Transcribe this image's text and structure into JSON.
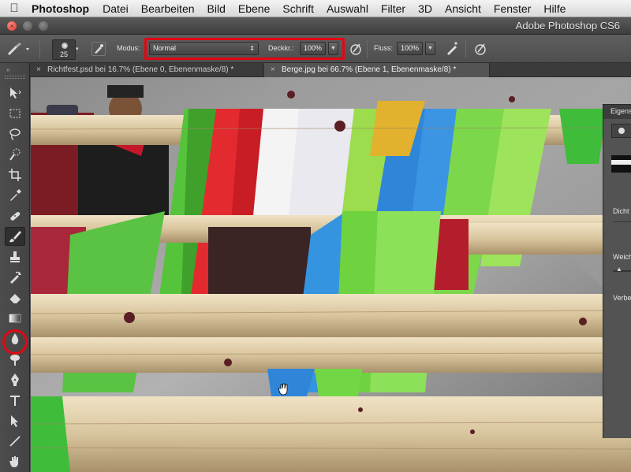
{
  "menubar": {
    "app_name": "Photoshop",
    "items": [
      "Datei",
      "Bearbeiten",
      "Bild",
      "Ebene",
      "Schrift",
      "Auswahl",
      "Filter",
      "3D",
      "Ansicht",
      "Fenster",
      "Hilfe"
    ]
  },
  "window": {
    "title": "Adobe Photoshop CS6"
  },
  "options": {
    "brush_size": "25",
    "mode_label": "Modus:",
    "mode_value": "Normal",
    "opacity_label": "Deckkr.:",
    "opacity_value": "100%",
    "flow_label": "Fluss:",
    "flow_value": "100%"
  },
  "tabs": [
    {
      "label": "Richtfest.psd bei 16.7% (Ebene 0, Ebenenmaske/8) *",
      "active": false
    },
    {
      "label": "Berge.jpg bei 66.7% (Ebene 1, Ebenenmaske/8) *",
      "active": true
    }
  ],
  "panel": {
    "title": "Eigens",
    "density_label": "Dicht",
    "feather_label": "Weich",
    "refine_label": "Verbes"
  },
  "colors": {
    "highlight": "#e30613",
    "ui_dark": "#535353"
  }
}
